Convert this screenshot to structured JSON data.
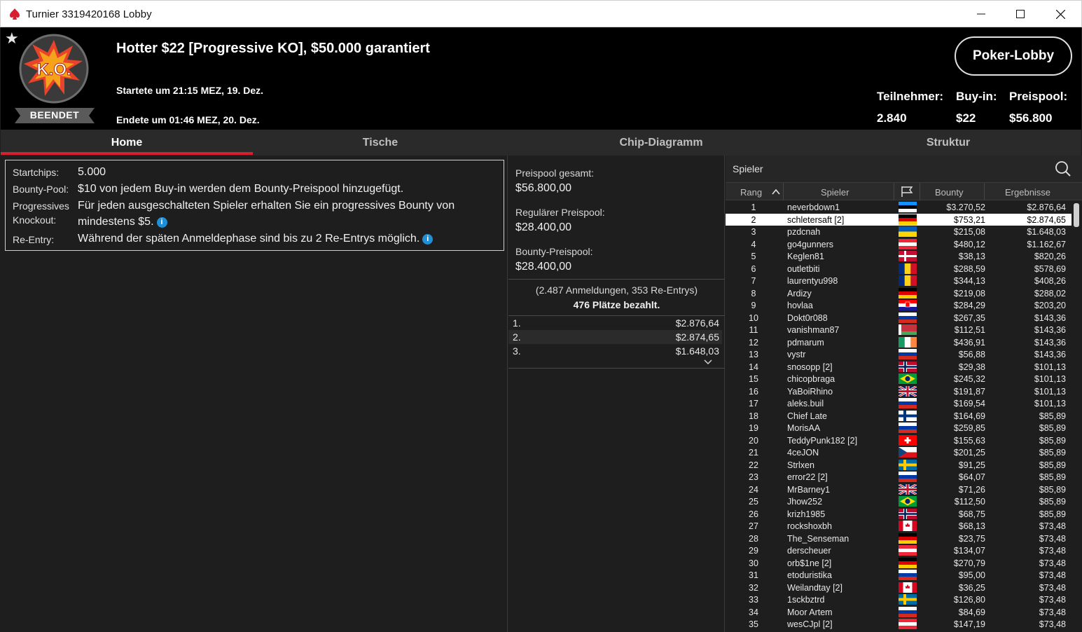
{
  "window": {
    "title": "Turnier 3319420168 Lobby"
  },
  "header": {
    "status": "BEENDET",
    "logo_text": "K.O.",
    "title": "Hotter $22 [Progressive KO], $50.000 garantiert",
    "start": "Startete um 21:15 MEZ, 19. Dez.",
    "end": "Endete um 01:46 MEZ, 20. Dez.",
    "lobby_button": "Poker-Lobby",
    "stats": [
      {
        "label": "Teilnehmer:",
        "value": "2.840"
      },
      {
        "label": "Buy-in:",
        "value": "$22"
      },
      {
        "label": "Preispool:",
        "value": "$56.800"
      }
    ]
  },
  "tabs": [
    "Home",
    "Tische",
    "Chip-Diagramm",
    "Struktur"
  ],
  "info": {
    "startchips_label": "Startchips:",
    "startchips_value": "5.000",
    "bounty_label": "Bounty-Pool:",
    "bounty_value": "$10 von jedem Buy-in werden dem Bounty-Preispool hinzugefügt.",
    "pko_label_1": "Progressives",
    "pko_label_2": "Knockout:",
    "pko_value_1": "Für jeden ausgeschalteten Spieler erhalten Sie ein progressives Bounty von",
    "pko_value_2": "mindestens $5.",
    "reentry_label": "Re-Entry:",
    "reentry_value": "Während der späten Anmeldephase sind bis zu 2 Re-Entrys möglich.",
    "info_glyph": "i"
  },
  "prizepool": {
    "total_label": "Preispool gesamt:",
    "total_value": "$56.800,00",
    "regular_label": "Regulärer Preispool:",
    "regular_value": "$28.400,00",
    "bounty_label": "Bounty-Preispool:",
    "bounty_value": "$28.400,00",
    "entries_text": "(2.487 Anmeldungen, 353 Re-Entrys)",
    "paid_text": "476 Plätze bezahlt.",
    "payouts": [
      {
        "place": "1.",
        "amount": "$2.876,64"
      },
      {
        "place": "2.",
        "amount": "$2.874,65"
      },
      {
        "place": "3.",
        "amount": "$1.648,03"
      }
    ]
  },
  "players": {
    "search_label": "Spieler",
    "columns": {
      "rank": "Rang",
      "player": "Spieler",
      "bounty": "Bounty",
      "result": "Ergebnisse"
    },
    "selected_rank": "2",
    "rows": [
      {
        "rank": "1",
        "name": "neverbdown1",
        "flag": "ee",
        "bounty": "$3.270,52",
        "result": "$2.876,64"
      },
      {
        "rank": "2",
        "name": "schletersaft [2]",
        "flag": "de",
        "bounty": "$753,21",
        "result": "$2.874,65"
      },
      {
        "rank": "3",
        "name": "pzdcnah",
        "flag": "ua",
        "bounty": "$215,08",
        "result": "$1.648,03"
      },
      {
        "rank": "4",
        "name": "go4gunners",
        "flag": "at",
        "bounty": "$480,12",
        "result": "$1.162,67"
      },
      {
        "rank": "5",
        "name": "Keglen81",
        "flag": "dk",
        "bounty": "$38,13",
        "result": "$820,26"
      },
      {
        "rank": "6",
        "name": "outletbiti",
        "flag": "ro",
        "bounty": "$288,59",
        "result": "$578,69"
      },
      {
        "rank": "7",
        "name": "laurentyu998",
        "flag": "ro",
        "bounty": "$344,13",
        "result": "$408,26"
      },
      {
        "rank": "8",
        "name": "Ardizy",
        "flag": "de",
        "bounty": "$219,08",
        "result": "$288,02"
      },
      {
        "rank": "9",
        "name": "hovlaa",
        "flag": "hr",
        "bounty": "$284,29",
        "result": "$203,20"
      },
      {
        "rank": "10",
        "name": "Dokt0r088",
        "flag": "ru",
        "bounty": "$267,35",
        "result": "$143,36"
      },
      {
        "rank": "11",
        "name": "vanishman87",
        "flag": "by",
        "bounty": "$112,51",
        "result": "$143,36"
      },
      {
        "rank": "12",
        "name": "pdmarum",
        "flag": "ie",
        "bounty": "$436,91",
        "result": "$143,36"
      },
      {
        "rank": "13",
        "name": "vystr",
        "flag": "ru",
        "bounty": "$56,88",
        "result": "$143,36"
      },
      {
        "rank": "14",
        "name": "snosopp [2]",
        "flag": "no",
        "bounty": "$29,38",
        "result": "$101,13"
      },
      {
        "rank": "15",
        "name": "chicopbraga",
        "flag": "br",
        "bounty": "$245,32",
        "result": "$101,13"
      },
      {
        "rank": "16",
        "name": "YaBoiRhino",
        "flag": "gb",
        "bounty": "$191,87",
        "result": "$101,13"
      },
      {
        "rank": "17",
        "name": "aleks.buil",
        "flag": "ru",
        "bounty": "$169,54",
        "result": "$101,13"
      },
      {
        "rank": "18",
        "name": "Chief Late",
        "flag": "fi",
        "bounty": "$164,69",
        "result": "$85,89"
      },
      {
        "rank": "19",
        "name": "MorisAA",
        "flag": "ru",
        "bounty": "$259,85",
        "result": "$85,89"
      },
      {
        "rank": "20",
        "name": "TeddyPunk182 [2]",
        "flag": "ch",
        "bounty": "$155,63",
        "result": "$85,89"
      },
      {
        "rank": "21",
        "name": "4ceJON",
        "flag": "cz",
        "bounty": "$201,25",
        "result": "$85,89"
      },
      {
        "rank": "22",
        "name": "Strlxen",
        "flag": "se",
        "bounty": "$91,25",
        "result": "$85,89"
      },
      {
        "rank": "23",
        "name": "error22 [2]",
        "flag": "ru",
        "bounty": "$64,07",
        "result": "$85,89"
      },
      {
        "rank": "24",
        "name": "MrBarney1",
        "flag": "gb",
        "bounty": "$71,26",
        "result": "$85,89"
      },
      {
        "rank": "25",
        "name": "Jhow252",
        "flag": "br",
        "bounty": "$112,50",
        "result": "$85,89"
      },
      {
        "rank": "26",
        "name": "krizh1985",
        "flag": "no",
        "bounty": "$68,75",
        "result": "$85,89"
      },
      {
        "rank": "27",
        "name": "rockshoxbh",
        "flag": "ca",
        "bounty": "$68,13",
        "result": "$73,48"
      },
      {
        "rank": "28",
        "name": "The_Senseman",
        "flag": "de",
        "bounty": "$23,75",
        "result": "$73,48"
      },
      {
        "rank": "29",
        "name": "derscheuer",
        "flag": "at",
        "bounty": "$134,07",
        "result": "$73,48"
      },
      {
        "rank": "30",
        "name": "orb$1ne [2]",
        "flag": "de",
        "bounty": "$270,79",
        "result": "$73,48"
      },
      {
        "rank": "31",
        "name": "etoduristika",
        "flag": "ru",
        "bounty": "$95,00",
        "result": "$73,48"
      },
      {
        "rank": "32",
        "name": "Weilandtay [2]",
        "flag": "ca",
        "bounty": "$36,25",
        "result": "$73,48"
      },
      {
        "rank": "33",
        "name": "1sckbztrd",
        "flag": "se",
        "bounty": "$126,80",
        "result": "$73,48"
      },
      {
        "rank": "34",
        "name": "Moor Artem",
        "flag": "ru",
        "bounty": "$84,69",
        "result": "$73,48"
      },
      {
        "rank": "35",
        "name": "wesCJpl [2]",
        "flag": "at",
        "bounty": "$147,19",
        "result": "$73,48"
      }
    ]
  }
}
